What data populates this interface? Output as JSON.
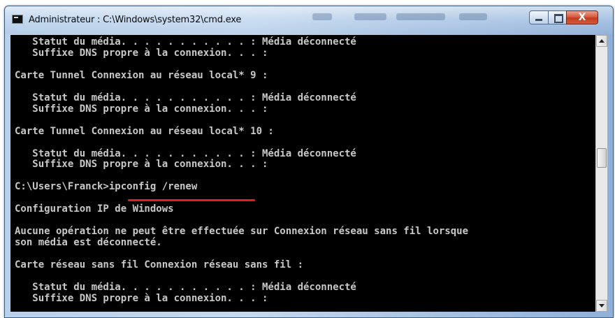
{
  "window": {
    "title": "Administrateur : C:\\Windows\\system32\\cmd.exe",
    "close_label": "X"
  },
  "console": {
    "lines": [
      "   Statut du média. . . . . . . . . . . : Média déconnecté",
      "   Suffixe DNS propre à la connexion. . . :",
      "",
      "Carte Tunnel Connexion au réseau local* 9 :",
      "",
      "   Statut du média. . . . . . . . . . . : Média déconnecté",
      "   Suffixe DNS propre à la connexion. . . :",
      "",
      "Carte Tunnel Connexion au réseau local* 10 :",
      "",
      "   Statut du média. . . . . . . . . . . : Média déconnecté",
      "   Suffixe DNS propre à la connexion. . . :",
      "",
      "C:\\Users\\Franck>ipconfig /renew",
      "",
      "Configuration IP de Windows",
      "",
      "Aucune opération ne peut être effectuée sur Connexion réseau sans fil lorsque",
      "son média est déconnecté.",
      "",
      "Carte réseau sans fil Connexion réseau sans fil :",
      "",
      "   Statut du média. . . . . . . . . . . : Média déconnecté",
      "   Suffixe DNS propre à la connexion. . . :"
    ]
  },
  "colors": {
    "console_background": "#000000",
    "console_text": "#c8c8c8",
    "highlight_underline": "#e02020"
  }
}
